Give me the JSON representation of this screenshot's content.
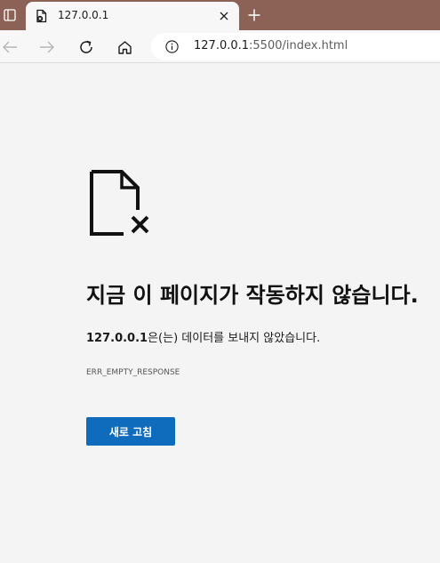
{
  "browser": {
    "tab": {
      "title": "127.0.0.1",
      "favicon": "error-page-icon"
    },
    "new_tab_label": "+",
    "address": {
      "host": "127.0.0.1",
      "rest": ":5500/index.html"
    }
  },
  "page": {
    "title": "지금 이 페이지가 작동하지 않습니다.",
    "description_host": "127.0.0.1",
    "description_text": "은(는) 데이터를 보내지 않았습니다.",
    "error_code": "ERR_EMPTY_RESPONSE",
    "reload_label": "새로 고침"
  },
  "colors": {
    "tabstrip": "#8c6156",
    "button": "#0f6cbd",
    "background": "#f4f4f4"
  }
}
